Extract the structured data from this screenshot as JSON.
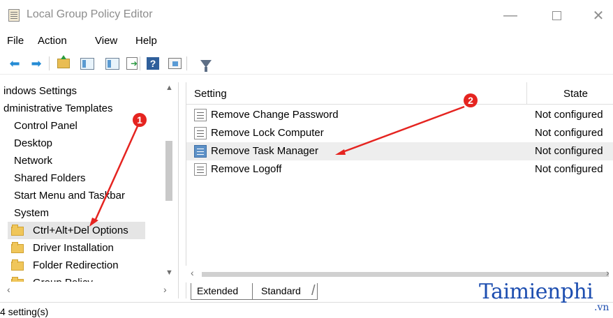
{
  "window": {
    "title": "Local Group Policy Editor",
    "minimize": "—",
    "close": "✕"
  },
  "menu": {
    "file": "File",
    "action": "Action",
    "view": "View",
    "help": "Help"
  },
  "toolbar": {
    "back_icon": "back-arrow",
    "forward_icon": "forward-arrow",
    "help_label": "?"
  },
  "tree": {
    "items": [
      "indows Settings",
      "dministrative Templates",
      "Control Panel",
      "Desktop",
      "Network",
      "Shared Folders",
      "Start Menu and Taskbar",
      "System",
      "Ctrl+Alt+Del Options",
      "Driver Installation",
      "Folder Redirection",
      "Group Policy"
    ]
  },
  "list": {
    "headers": {
      "setting": "Setting",
      "state": "State"
    },
    "rows": [
      {
        "name": "Remove Change Password",
        "state": "Not configured"
      },
      {
        "name": "Remove Lock Computer",
        "state": "Not configured"
      },
      {
        "name": "Remove Task Manager",
        "state": "Not configured"
      },
      {
        "name": "Remove Logoff",
        "state": "Not configured"
      }
    ]
  },
  "tabs": {
    "extended": "Extended",
    "standard": "Standard"
  },
  "status": {
    "text": "4 setting(s)"
  },
  "annotations": {
    "badge_1": "1",
    "badge_2": "2",
    "color": "#e52420"
  },
  "watermark": {
    "brand": "Taimienphi",
    "domain": ".vn"
  }
}
